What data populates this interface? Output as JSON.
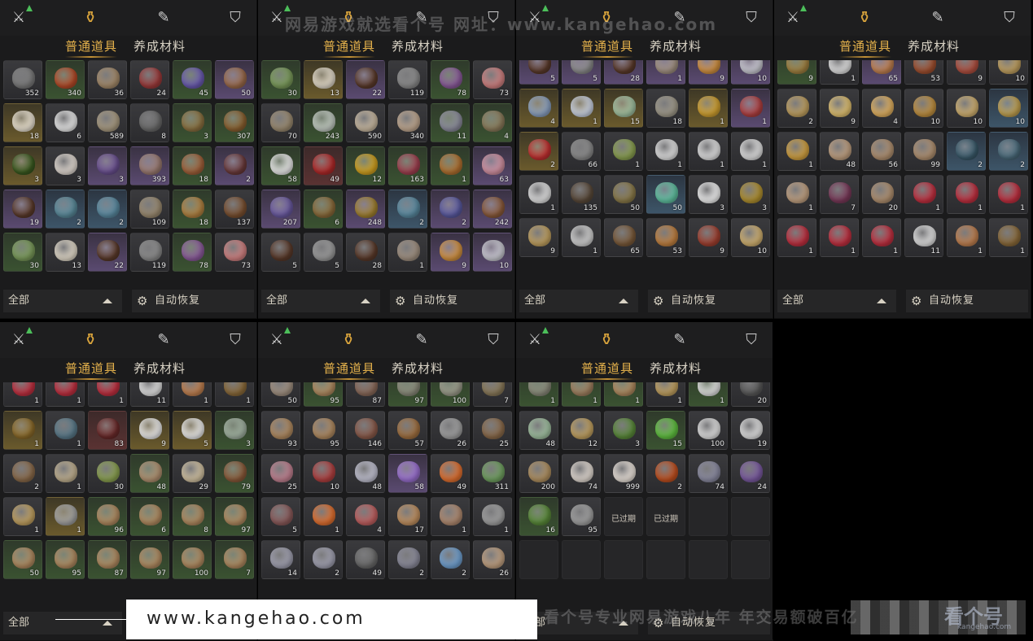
{
  "tabs": {
    "normal": "普通道具",
    "materials": "养成材料"
  },
  "footer": {
    "filter": "全部",
    "auto_restore": "自动恢复"
  },
  "watermarks": {
    "top": "网易游戏就选看个号  网址：www.kangehao.com",
    "url": "www.kangehao.com",
    "slogan": "看个号专业网易游戏八年  年交易额破百亿",
    "logo": "看个号",
    "logo_sub": "kangehao.com"
  },
  "icons": {
    "bag": "bag-icon",
    "sword": "sword-icon",
    "scroll": "scroll-icon",
    "badge": "badge-icon",
    "gear": "gear-icon"
  },
  "expired_label": "已过期",
  "panels": [
    {
      "offset": 0,
      "items": [
        [
          "d",
          "#7a7a7a",
          "352"
        ],
        [
          "g",
          "#b44a28",
          "340"
        ],
        [
          "d",
          "#a48a6a",
          "36"
        ],
        [
          "d",
          "#9c3a3a",
          "24"
        ],
        [
          "g",
          "#6a5ab0",
          "45"
        ],
        [
          "p",
          "#9a6a4a",
          "50"
        ],
        [
          "y",
          "#e8e0d0",
          "18"
        ],
        [
          "d",
          "#e8e8e8",
          "6"
        ],
        [
          "d",
          "#a89a80",
          "589"
        ],
        [
          "d",
          "#6a6a6a",
          "8"
        ],
        [
          "g",
          "#8a7040",
          "3"
        ],
        [
          "g",
          "#8a6030",
          "307"
        ],
        [
          "y",
          "#3a5a20",
          "3"
        ],
        [
          "d",
          "#e0d8d0",
          "3"
        ],
        [
          "p",
          "#6a5090",
          "3"
        ],
        [
          "p",
          "#9a7a70",
          "393"
        ],
        [
          "g",
          "#a0603a",
          "18"
        ],
        [
          "p",
          "#6a3a3a",
          "2"
        ],
        [
          "p",
          "#5a3a2a",
          "19"
        ],
        [
          "b",
          "#5a8a9a",
          "2"
        ],
        [
          "b",
          "#5a8aa0",
          "2"
        ],
        [
          "d",
          "#9a8a70",
          "109"
        ],
        [
          "g",
          "#b08040",
          "18"
        ],
        [
          "d",
          "#7a5030",
          "137"
        ],
        [
          "g",
          "#7a9a5a",
          "30"
        ],
        [
          "d",
          "#e0d8c8",
          "13"
        ],
        [
          "p",
          "#5a3a2a",
          "22"
        ],
        [
          "d",
          "#8a8a8a",
          "119"
        ],
        [
          "g",
          "#8a5a9a",
          "78"
        ],
        [
          "d",
          "#d08080",
          "73"
        ]
      ]
    },
    {
      "offset": 0,
      "items": [
        [
          "g",
          "#7a9a5a",
          "30"
        ],
        [
          "y",
          "#e0d8c8",
          "13"
        ],
        [
          "p",
          "#5a3a2a",
          "22"
        ],
        [
          "d",
          "#8a8a8a",
          "119"
        ],
        [
          "g",
          "#8a5a9a",
          "78"
        ],
        [
          "d",
          "#d08080",
          "73"
        ],
        [
          "d",
          "#9a8a70",
          "70"
        ],
        [
          "g",
          "#c0c8c0",
          "243"
        ],
        [
          "d",
          "#c8b8a0",
          "590"
        ],
        [
          "d",
          "#c0a890",
          "340"
        ],
        [
          "g",
          "#8a8a9a",
          "11"
        ],
        [
          "g",
          "#8a7a5a",
          "4"
        ],
        [
          "g",
          "#e8e8e8",
          "58"
        ],
        [
          "r",
          "#b02a2a",
          "49"
        ],
        [
          "g",
          "#d0a020",
          "12"
        ],
        [
          "g",
          "#a04050",
          "163"
        ],
        [
          "g",
          "#b07030",
          "1"
        ],
        [
          "p",
          "#d090a0",
          "63"
        ],
        [
          "p",
          "#6a5aa0",
          "207"
        ],
        [
          "g",
          "#8a6a3a",
          "6"
        ],
        [
          "p",
          "#a08030",
          "248"
        ],
        [
          "b",
          "#5a8aa0",
          "2"
        ],
        [
          "p",
          "#5a5aa0",
          "2"
        ],
        [
          "p",
          "#8a5a3a",
          "242"
        ],
        [
          "d",
          "#5a3a2a",
          "5"
        ],
        [
          "d",
          "#9a9a9a",
          "5"
        ],
        [
          "d",
          "#5a3a2a",
          "28"
        ],
        [
          "d",
          "#a09080",
          "1"
        ],
        [
          "p",
          "#d09040",
          "9"
        ],
        [
          "p",
          "#c8c8d0",
          "10"
        ]
      ]
    },
    {
      "offset": -18,
      "items": [
        [
          "p",
          "#5a3a2a",
          "5"
        ],
        [
          "p",
          "#8a8a8a",
          "5"
        ],
        [
          "p",
          "#5a3a2a",
          "28"
        ],
        [
          "p",
          "#a09080",
          "1"
        ],
        [
          "p",
          "#d09040",
          "9"
        ],
        [
          "p",
          "#c8c8d0",
          "10"
        ],
        [
          "y",
          "#8aa0c0",
          "4"
        ],
        [
          "y",
          "#c8d0e0",
          "1"
        ],
        [
          "y",
          "#a0c0a0",
          "15"
        ],
        [
          "d",
          "#a09a8a",
          "18"
        ],
        [
          "y",
          "#d0a030",
          "1"
        ],
        [
          "p",
          "#b04040",
          "1"
        ],
        [
          "y",
          "#c03030",
          "2"
        ],
        [
          "d",
          "#8a8a8a",
          "66"
        ],
        [
          "d",
          "#8aa050",
          "1"
        ],
        [
          "d",
          "#e0e0e0",
          "1"
        ],
        [
          "d",
          "#e0e0e0",
          "1"
        ],
        [
          "d",
          "#e0e0e0",
          "1"
        ],
        [
          "d",
          "#e0e0e0",
          "1"
        ],
        [
          "d",
          "#5a4a3a",
          "135"
        ],
        [
          "d",
          "#8a7a4a",
          "50"
        ],
        [
          "b",
          "#60c0a0",
          "50"
        ],
        [
          "d",
          "#f0f0f0",
          "3"
        ],
        [
          "d",
          "#b09030",
          "3"
        ],
        [
          "d",
          "#c0a060",
          "9"
        ],
        [
          "d",
          "#d0d0d0",
          "1"
        ],
        [
          "d",
          "#7a5a3a",
          "65"
        ],
        [
          "d",
          "#c08040",
          "53"
        ],
        [
          "d",
          "#a04030",
          "9"
        ],
        [
          "d",
          "#d0b070",
          "10"
        ]
      ]
    },
    {
      "offset": -18,
      "items": [
        [
          "g",
          "#a08040",
          "9"
        ],
        [
          "d",
          "#e0e0e0",
          "1"
        ],
        [
          "p",
          "#c08050",
          "65"
        ],
        [
          "d",
          "#a05030",
          "53"
        ],
        [
          "d",
          "#b05040",
          "9"
        ],
        [
          "d",
          "#c0a060",
          "10"
        ],
        [
          "d",
          "#c0a060",
          "2"
        ],
        [
          "d",
          "#e0c070",
          "9"
        ],
        [
          "d",
          "#e0b060",
          "4"
        ],
        [
          "d",
          "#c09040",
          "10"
        ],
        [
          "d",
          "#d0b070",
          "10"
        ],
        [
          "b",
          "#c0a050",
          "10"
        ],
        [
          "d",
          "#d0a040",
          "1"
        ],
        [
          "d",
          "#c0a080",
          "48"
        ],
        [
          "d",
          "#b09070",
          "56"
        ],
        [
          "d",
          "#b09070",
          "99"
        ],
        [
          "b",
          "#3a5a6a",
          "2"
        ],
        [
          "b",
          "#4a6a7a",
          "2"
        ],
        [
          "d",
          "#c0a080",
          "1"
        ],
        [
          "d",
          "#7a3a5a",
          "7"
        ],
        [
          "d",
          "#b09070",
          "20"
        ],
        [
          "d",
          "#c03040",
          "1"
        ],
        [
          "d",
          "#c03040",
          "1"
        ],
        [
          "d",
          "#c03040",
          "1"
        ],
        [
          "d",
          "#c03040",
          "1"
        ],
        [
          "d",
          "#c03040",
          "1"
        ],
        [
          "d",
          "#c03040",
          "1"
        ],
        [
          "d",
          "#e0e0e0",
          "11"
        ],
        [
          "d",
          "#c08050",
          "1"
        ],
        [
          "d",
          "#8a6a3a",
          "1"
        ]
      ]
    },
    {
      "offset": -18,
      "items": [
        [
          "d",
          "#c03040",
          "1"
        ],
        [
          "d",
          "#c03040",
          "1"
        ],
        [
          "d",
          "#c03040",
          "1"
        ],
        [
          "d",
          "#e0e0e0",
          "11"
        ],
        [
          "d",
          "#c08050",
          "1"
        ],
        [
          "d",
          "#8a6a3a",
          "1"
        ],
        [
          "y",
          "#8a6a2a",
          "1"
        ],
        [
          "d",
          "#5a7a8a",
          "1"
        ],
        [
          "r",
          "#6a2a2a",
          "83"
        ],
        [
          "y",
          "#e8e8e8",
          "9"
        ],
        [
          "y",
          "#e8e8e8",
          "5"
        ],
        [
          "g",
          "#a0b0a0",
          "3"
        ],
        [
          "d",
          "#8a6a4a",
          "2"
        ],
        [
          "d",
          "#c0b090",
          "1"
        ],
        [
          "d",
          "#8aa050",
          "30"
        ],
        [
          "g",
          "#b09070",
          "48"
        ],
        [
          "d",
          "#d0c0a0",
          "29"
        ],
        [
          "g",
          "#8a5a3a",
          "79"
        ],
        [
          "d",
          "#c0a060",
          "1"
        ],
        [
          "y",
          "#a0a0a0",
          "1"
        ],
        [
          "g",
          "#b08a60",
          "96"
        ],
        [
          "g",
          "#b08a60",
          "6"
        ],
        [
          "g",
          "#b08a60",
          "8"
        ],
        [
          "g",
          "#b08a60",
          "97"
        ],
        [
          "g",
          "#b08a60",
          "50"
        ],
        [
          "g",
          "#b08a60",
          "95"
        ],
        [
          "g",
          "#b08a60",
          "87"
        ],
        [
          "g",
          "#b08a60",
          "97"
        ],
        [
          "g",
          "#b08a60",
          "100"
        ],
        [
          "g",
          "#b08a60",
          "7"
        ]
      ]
    },
    {
      "offset": -18,
      "items": [
        [
          "d",
          "#a09080",
          "50"
        ],
        [
          "g",
          "#b08a60",
          "95"
        ],
        [
          "d",
          "#8a6a5a",
          "87"
        ],
        [
          "g",
          "#8a8a7a",
          "97"
        ],
        [
          "g",
          "#9a9a8a",
          "100"
        ],
        [
          "d",
          "#8a7a5a",
          "7"
        ],
        [
          "d",
          "#b08a60",
          "93"
        ],
        [
          "d",
          "#b08a60",
          "95"
        ],
        [
          "d",
          "#8a5a4a",
          "146"
        ],
        [
          "d",
          "#a07040",
          "57"
        ],
        [
          "d",
          "#a0a0a0",
          "26"
        ],
        [
          "d",
          "#8a6a4a",
          "25"
        ],
        [
          "d",
          "#c08090",
          "25"
        ],
        [
          "d",
          "#b04040",
          "10"
        ],
        [
          "d",
          "#c0c0d0",
          "48"
        ],
        [
          "p",
          "#9a70d0",
          "58"
        ],
        [
          "d",
          "#e07030",
          "49"
        ],
        [
          "d",
          "#70a060",
          "311"
        ],
        [
          "d",
          "#8a5a5a",
          "5"
        ],
        [
          "d",
          "#e07030",
          "1"
        ],
        [
          "d",
          "#c06060",
          "4"
        ],
        [
          "d",
          "#c09060",
          "17"
        ],
        [
          "d",
          "#b08a70",
          "1"
        ],
        [
          "d",
          "#a0a0a0",
          "1"
        ],
        [
          "d",
          "#a0a0b0",
          "14"
        ],
        [
          "d",
          "#a0a0b0",
          "2"
        ],
        [
          "d",
          "#6a6a6a",
          "49"
        ],
        [
          "d",
          "#8a8a9a",
          "2"
        ],
        [
          "d",
          "#70a0d0",
          "2"
        ],
        [
          "d",
          "#c0a080",
          "26"
        ]
      ]
    },
    {
      "offset": -18,
      "items": [
        [
          "g",
          "#8a8a7a",
          "1"
        ],
        [
          "g",
          "#a08060",
          "1"
        ],
        [
          "g",
          "#b08a60",
          "1"
        ],
        [
          "d",
          "#c0a060",
          "1"
        ],
        [
          "g",
          "#e0e0e0",
          "1"
        ],
        [
          "d",
          "#5a5a5a",
          "20"
        ],
        [
          "d",
          "#a0c0a0",
          "48"
        ],
        [
          "d",
          "#c0a060",
          "12"
        ],
        [
          "d",
          "#5a8a3a",
          "3"
        ],
        [
          "g",
          "#60c040",
          "15"
        ],
        [
          "d",
          "#e0e0e0",
          "100"
        ],
        [
          "d",
          "#e0e0e0",
          "19"
        ],
        [
          "d",
          "#b09060",
          "200"
        ],
        [
          "d",
          "#e0d8d0",
          "74"
        ],
        [
          "d",
          "#e8e0d8",
          "999"
        ],
        [
          "d",
          "#c05020",
          "2"
        ],
        [
          "d",
          "#8a8aa0",
          "74"
        ],
        [
          "d",
          "#7a5aa0",
          "24"
        ],
        [
          "g",
          "#5a8a3a",
          "16"
        ],
        [
          "d",
          "#a0a0a0",
          "95"
        ],
        [
          "e",
          "",
          "已过期"
        ],
        [
          "e",
          "",
          "已过期"
        ],
        [
          "e",
          "",
          ""
        ],
        [
          "e",
          "",
          ""
        ],
        [
          "e",
          "",
          ""
        ],
        [
          "e",
          "",
          ""
        ],
        [
          "e",
          "",
          ""
        ],
        [
          "e",
          "",
          ""
        ],
        [
          "e",
          "",
          ""
        ],
        [
          "e",
          "",
          ""
        ]
      ]
    }
  ]
}
